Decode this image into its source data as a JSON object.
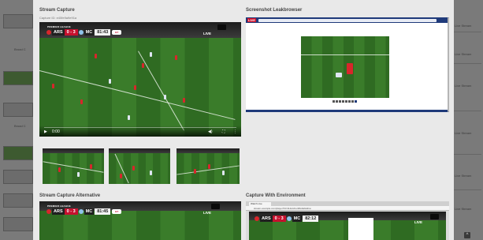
{
  "background": {
    "left_labels": [
      "Broad C",
      "Broad C"
    ],
    "right_labels": [
      "Live Stream",
      "Live Stream",
      "Live Stream",
      "Live Stream",
      "Live Stream",
      "Live Stream"
    ]
  },
  "sections": {
    "stream_capture": {
      "title": "Stream Capture",
      "subtitle": "Capture ID: e40fe9a9e91a"
    },
    "leak_browser": {
      "title": "Screenshot Leakbrowser"
    },
    "stream_alt": {
      "title": "Stream Capture Alternative"
    },
    "capture_env": {
      "title": "Capture With Environment"
    }
  },
  "scorebug": {
    "league": "PREMIER LEAGUE",
    "home": "ARS",
    "score": "0 - 3",
    "away": "MC",
    "clock_main": "81:43",
    "clock_alt": "81:45",
    "clock_env": "82:12",
    "live_label": "LIVE"
  },
  "player": {
    "time": "0:00",
    "play_icon": "play-icon",
    "volume_icon": "volume-icon",
    "settings_icon": "settings-icon",
    "fullscreen_icon": "fullscreen-icon",
    "more_icon": "more-icon"
  },
  "leak": {
    "live_badge": "LIVE",
    "pager_label": "Result: 1 2 3 4 5 6 7 8"
  },
  "env": {
    "tab_label": "Watch Live",
    "url": "stream.example.com/player?id=11&cid=e40fe9a9e91a"
  },
  "colors": {
    "accent_red": "#c5102e",
    "pitch_green": "#3a7c2a",
    "leak_blue": "#1f3a7a"
  }
}
